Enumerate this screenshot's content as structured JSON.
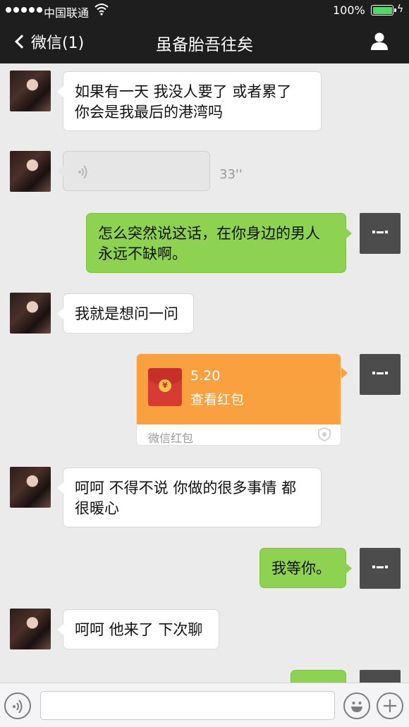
{
  "status_bar": {
    "carrier": "中国联通",
    "battery": "100%"
  },
  "nav": {
    "back_label": "微信(1)",
    "title": "虽备胎吾往矣"
  },
  "messages": [
    {
      "from": "her",
      "text_line1": "如果有一天 我没人要了 或者累了",
      "text_line2": "你会是我最后的港湾吗"
    },
    {
      "from": "her",
      "type": "voice",
      "duration": "33''"
    },
    {
      "from": "me",
      "text_line1": "怎么突然说这话，在你身边的男人",
      "text_line2": "永远不缺啊。"
    },
    {
      "from": "her",
      "text": "我就是想问一问"
    },
    {
      "from": "me",
      "type": "red_packet",
      "amount": "5.20",
      "action": "查看红包",
      "footer": "微信红包"
    },
    {
      "from": "her",
      "text_line1": "呵呵 不得不说 你做的很多事情 都",
      "text_line2": "很暖心"
    },
    {
      "from": "me",
      "text": "我等你。"
    },
    {
      "from": "her",
      "text": "呵呵 他来了 下次聊"
    }
  ],
  "input": {
    "placeholder": ""
  },
  "icons": {
    "voice_toggle": "voice-icon",
    "emoji": "emoji-icon",
    "more": "plus-icon",
    "profile": "profile-icon",
    "back": "chevron-left-icon"
  },
  "colors": {
    "my_bubble": "#8ed251",
    "red_packet": "#f9a03f",
    "nav_bg": "#1e1e1e"
  }
}
